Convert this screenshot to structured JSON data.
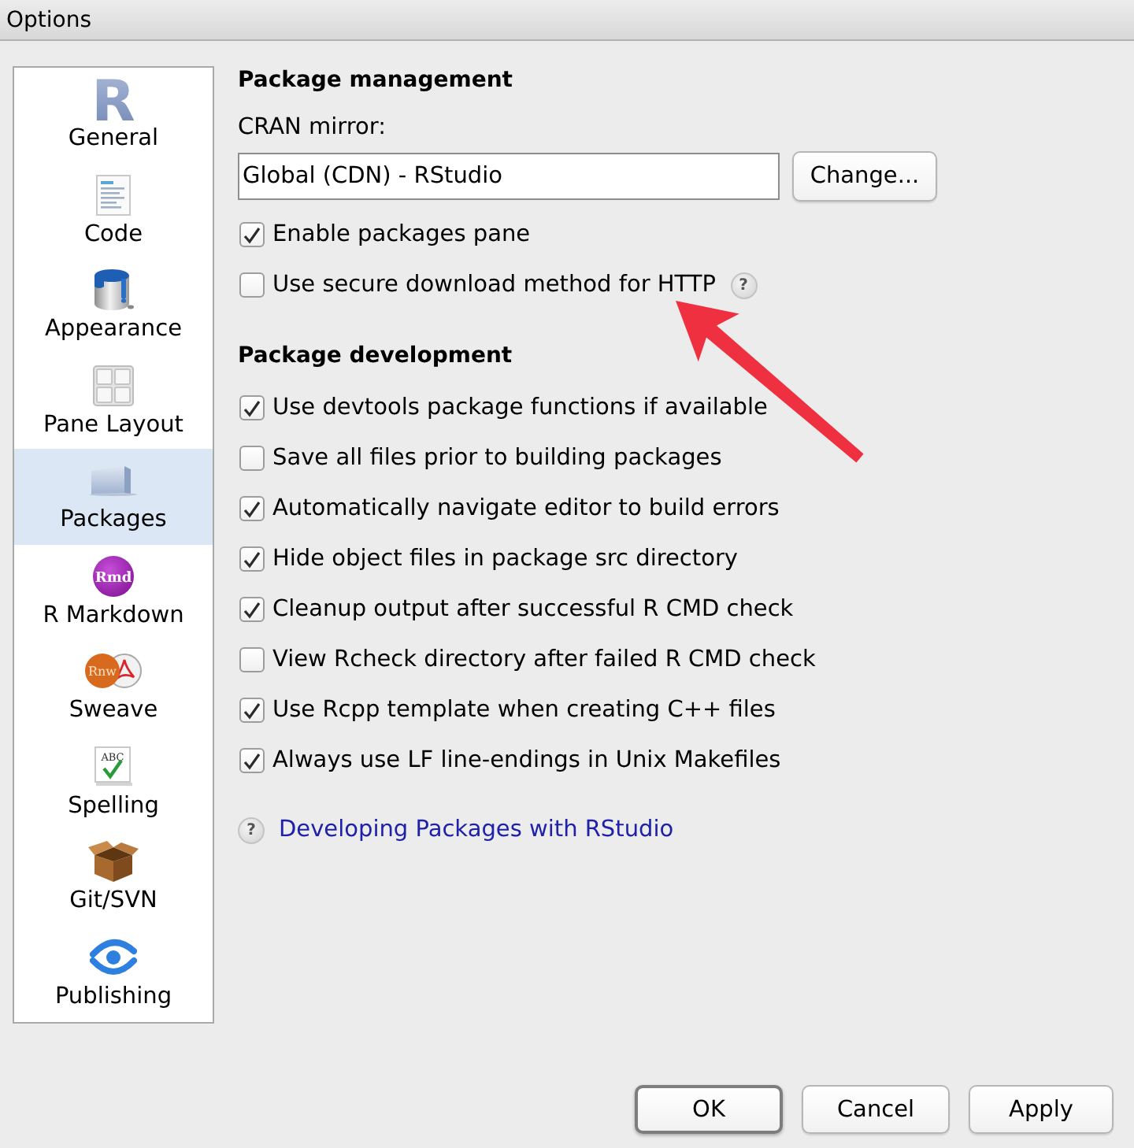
{
  "window": {
    "title": "Options"
  },
  "sidebar": {
    "items": [
      {
        "label": "General",
        "icon_text": "R",
        "selected": false
      },
      {
        "label": "Code",
        "selected": false
      },
      {
        "label": "Appearance",
        "selected": false
      },
      {
        "label": "Pane Layout",
        "selected": false
      },
      {
        "label": "Packages",
        "selected": true
      },
      {
        "label": "R Markdown",
        "icon_text": "Rmd",
        "selected": false
      },
      {
        "label": "Sweave",
        "icon_text": "Rnw",
        "selected": false
      },
      {
        "label": "Spelling",
        "icon_text": "ABC",
        "selected": false
      },
      {
        "label": "Git/SVN",
        "selected": false
      },
      {
        "label": "Publishing",
        "selected": false
      }
    ]
  },
  "package_management": {
    "heading": "Package management",
    "cran_mirror": {
      "label": "CRAN mirror:",
      "value": "Global (CDN) - RStudio",
      "button": "Change..."
    },
    "options": [
      {
        "label": "Enable packages pane",
        "checked": true
      },
      {
        "label": "Use secure download method for HTTP",
        "checked": false,
        "help": "?"
      }
    ]
  },
  "package_development": {
    "heading": "Package development",
    "options": [
      {
        "label": "Use devtools package functions if available",
        "checked": true
      },
      {
        "label": "Save all files prior to building packages",
        "checked": false
      },
      {
        "label": "Automatically navigate editor to build errors",
        "checked": true
      },
      {
        "label": "Hide object files in package src directory",
        "checked": true
      },
      {
        "label": "Cleanup output after successful R CMD check",
        "checked": true
      },
      {
        "label": "View Rcheck directory after failed R CMD check",
        "checked": false
      },
      {
        "label": "Use Rcpp template when creating C++ files",
        "checked": true
      },
      {
        "label": "Always use LF line-endings in Unix Makefiles",
        "checked": true
      }
    ],
    "help_link": {
      "help": "?",
      "label": "Developing Packages with RStudio"
    }
  },
  "buttons": [
    {
      "label": "OK",
      "default": true
    },
    {
      "label": "Cancel",
      "default": false
    },
    {
      "label": "Apply",
      "default": false
    }
  ]
}
